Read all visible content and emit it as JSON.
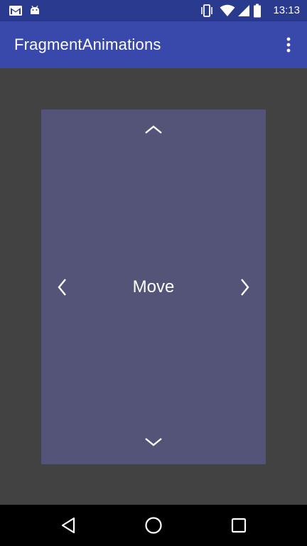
{
  "status_bar": {
    "time": "13:13",
    "left_icons": [
      "gmail-icon",
      "android-icon"
    ],
    "right_icons": [
      "vibrate-icon",
      "wifi-icon",
      "cell-signal-icon",
      "battery-icon"
    ]
  },
  "app_bar": {
    "title": "FragmentAnimations",
    "overflow_icon": "more-vert-icon"
  },
  "card": {
    "label": "Move",
    "arrows": [
      "chevron-up-icon",
      "chevron-down-icon",
      "chevron-left-icon",
      "chevron-right-icon"
    ]
  },
  "nav_bar": {
    "buttons": [
      "back-icon",
      "home-icon",
      "recents-icon"
    ]
  },
  "colors": {
    "status_bar": "#2a3a8f",
    "app_bar": "#3949ab",
    "background": "#424242",
    "card": "#545378",
    "nav_bar": "#000000"
  }
}
